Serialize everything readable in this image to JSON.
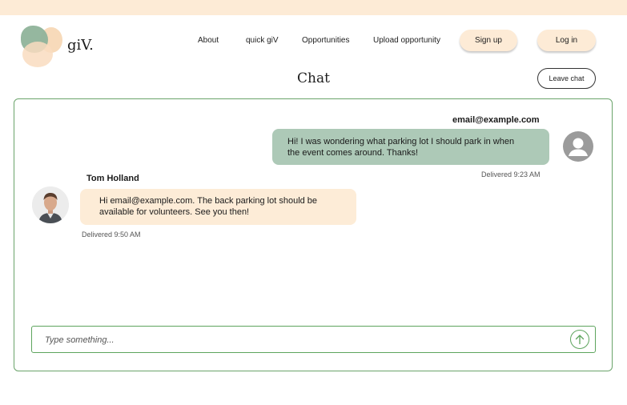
{
  "brand": {
    "name": "giV."
  },
  "nav": {
    "about": "About",
    "quick_giv": "quick giV",
    "opportunities": "Opportunities",
    "upload": "Upload opportunity"
  },
  "auth": {
    "signup": "Sign up",
    "login": "Log in"
  },
  "page": {
    "title": "Chat",
    "leave_label": "Leave chat"
  },
  "messages": [
    {
      "sender": "email@example.com",
      "text_line1": "Hi! I was wondering what parking lot I should park in when",
      "text_line2": "the event comes around. Thanks!",
      "status": "Delivered 9:23 AM"
    },
    {
      "sender": "Tom Holland",
      "text_line1": "Hi email@example.com. The back parking lot should be",
      "text_line2": "available for volunteers. See you then!",
      "status": "Delivered 9:50 AM"
    }
  ],
  "composer": {
    "placeholder": "Type something..."
  },
  "colors": {
    "accent_green": "#5da45d",
    "sent_bubble": "#adc9b7",
    "received_bubble": "#fdecd7",
    "peach": "#fdebd6"
  },
  "icons": {
    "generic_avatar": "user-icon",
    "send": "arrow-up-icon"
  }
}
